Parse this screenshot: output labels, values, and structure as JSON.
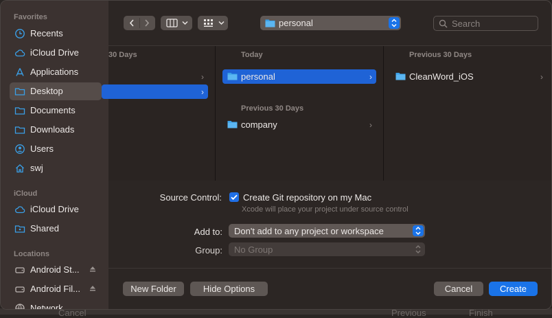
{
  "sidebar": {
    "favorites_header": "Favorites",
    "favorites": [
      {
        "label": "Recents",
        "icon": "clock-icon"
      },
      {
        "label": "iCloud Drive",
        "icon": "cloud-icon"
      },
      {
        "label": "Applications",
        "icon": "applications-icon"
      },
      {
        "label": "Desktop",
        "icon": "folder-icon",
        "selected": true
      },
      {
        "label": "Documents",
        "icon": "folder-icon"
      },
      {
        "label": "Downloads",
        "icon": "folder-icon"
      },
      {
        "label": "Users",
        "icon": "user-icon"
      },
      {
        "label": "swj",
        "icon": "home-icon"
      }
    ],
    "icloud_header": "iCloud",
    "icloud": [
      {
        "label": "iCloud Drive",
        "icon": "cloud-icon"
      },
      {
        "label": "Shared",
        "icon": "shared-folder-icon"
      }
    ],
    "locations_header": "Locations",
    "locations": [
      {
        "label": "Android St...",
        "icon": "disk-icon"
      },
      {
        "label": "Android Fil...",
        "icon": "disk-icon"
      },
      {
        "label": "Network",
        "icon": "network-icon"
      }
    ]
  },
  "toolbar": {
    "location": "personal",
    "search_placeholder": "Search"
  },
  "columns": [
    {
      "header": "30 Days",
      "rows": [
        {
          "label": "",
          "selected": false
        },
        {
          "label": "",
          "selected": true
        }
      ]
    },
    {
      "header": "Today",
      "rows": [
        {
          "label": "personal",
          "selected": true
        }
      ],
      "header2": "Previous 30 Days",
      "rows2": [
        {
          "label": "company",
          "selected": false
        }
      ]
    },
    {
      "header": "Previous 30 Days",
      "rows": [
        {
          "label": "CleanWord_iOS",
          "selected": false
        }
      ]
    }
  ],
  "options": {
    "source_control_label": "Source Control:",
    "git_checkbox_label": "Create Git repository on my Mac",
    "git_hint": "Xcode will place your project under source control",
    "add_to_label": "Add to:",
    "add_to_value": "Don't add to any project or workspace",
    "group_label": "Group:",
    "group_value": "No Group"
  },
  "buttons": {
    "new_folder": "New Folder",
    "hide_options": "Hide Options",
    "cancel": "Cancel",
    "create": "Create"
  },
  "underlay": {
    "cancel": "Cancel",
    "previous": "Previous",
    "finish": "Finish"
  },
  "colors": {
    "accent": "#1a73e8",
    "selection": "#1f63d6",
    "folder": "#3aa0e8"
  }
}
